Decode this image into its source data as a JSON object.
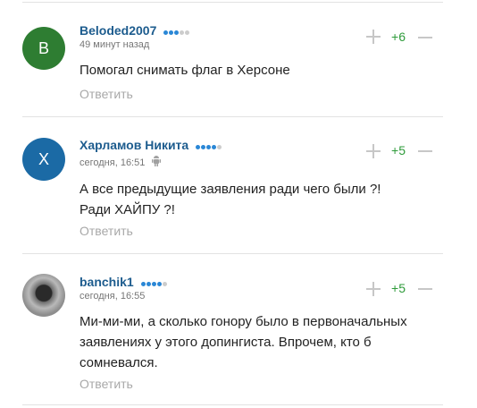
{
  "comments": [
    {
      "avatar_letter": "B",
      "avatar_color": "#2e7d32",
      "author": "Beloded2007",
      "rating_dots_filled": 3,
      "rating_dots_total": 5,
      "time": "49 минут назад",
      "text": "Помогал снимать флаг в Херсоне",
      "reply_label": "Ответить",
      "score": "+6"
    },
    {
      "avatar_letter": "X",
      "avatar_color": "#1b6aa5",
      "author": "Харламов Никита",
      "rating_dots_filled": 4,
      "rating_dots_total": 5,
      "time": "сегодня, 16:51",
      "device_icon": "android-icon",
      "text_lines": [
        "А все предыдущие заявления ради чего были ?!",
        "Ради ХАЙПУ ?!"
      ],
      "reply_label": "Ответить",
      "score": "+5"
    },
    {
      "avatar_letter": "",
      "avatar_type": "photo",
      "author": "banchik1",
      "rating_dots_filled": 4,
      "rating_dots_total": 5,
      "time": "сегодня, 16:55",
      "text_lines": [
        "Ми-ми-ми, а сколько гонору было в первоначальных",
        "заявлениях у этого допингиста. Впрочем, кто б",
        "сомневался."
      ],
      "reply_label": "Ответить",
      "score": "+5"
    }
  ],
  "colors": {
    "author": "#1d5c8e",
    "score_positive": "#2e9b3a",
    "rating_dot": "#2a87d6",
    "muted": "#a8a8a8"
  }
}
